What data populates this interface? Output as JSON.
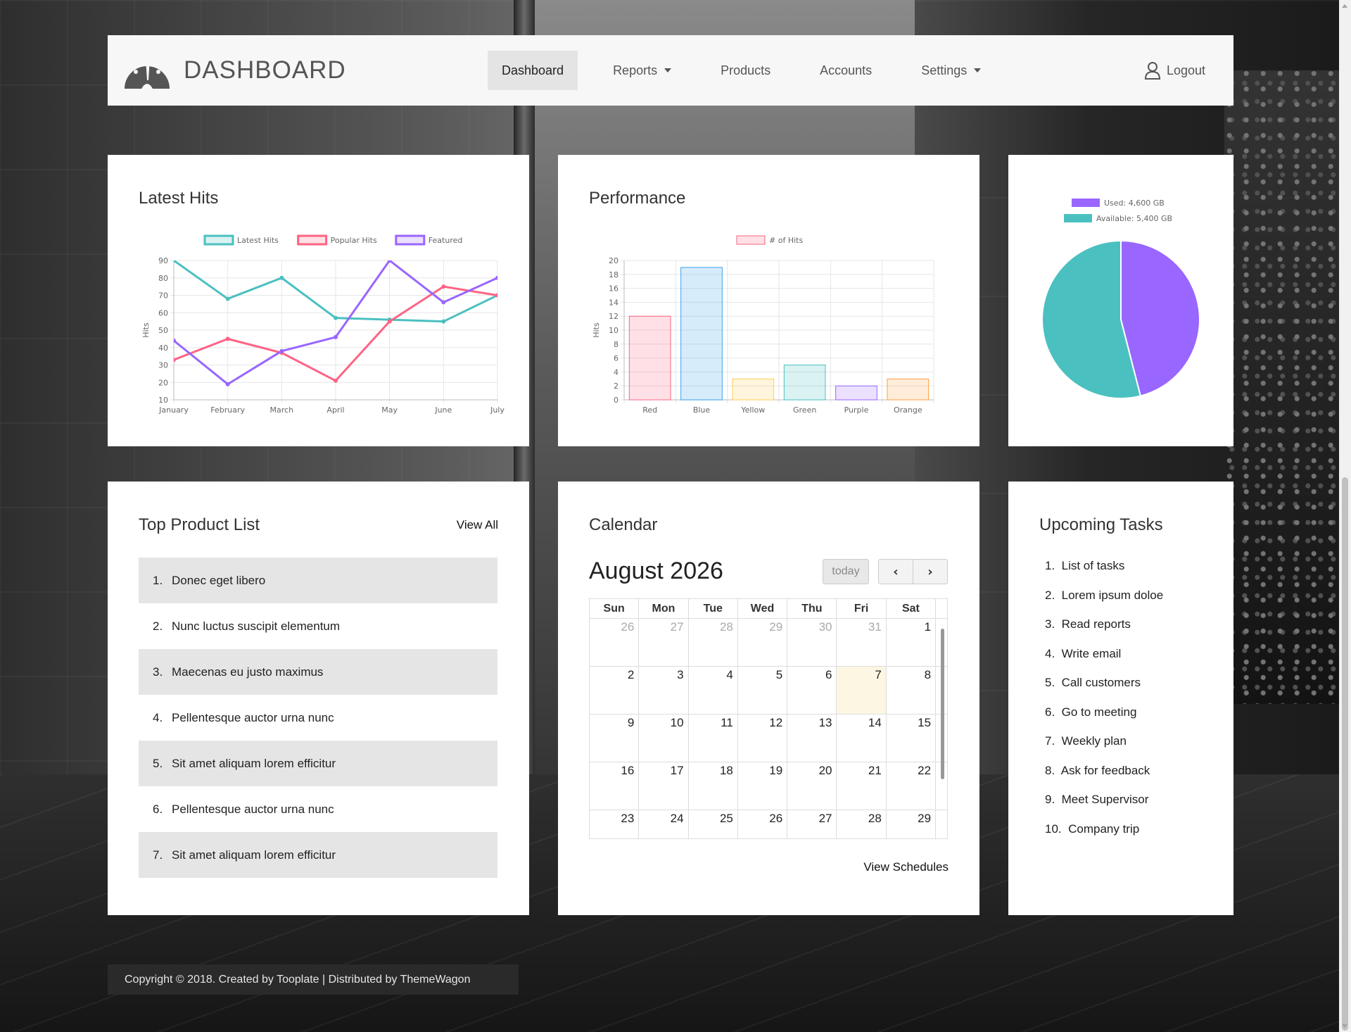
{
  "brand": {
    "title": "DASHBOARD",
    "icon": "speedometer-icon"
  },
  "nav": {
    "items": [
      {
        "label": "Dashboard",
        "active": true
      },
      {
        "label": "Reports",
        "dropdown": true
      },
      {
        "label": "Products"
      },
      {
        "label": "Accounts"
      },
      {
        "label": "Settings",
        "dropdown": true
      }
    ],
    "logout": "Logout"
  },
  "latest_hits": {
    "title": "Latest Hits",
    "chart_data": {
      "type": "line",
      "categories": [
        "January",
        "February",
        "March",
        "April",
        "May",
        "June",
        "July"
      ],
      "series": [
        {
          "name": "Latest Hits",
          "color": "#4bc0c0",
          "values": [
            90,
            68,
            80,
            57,
            56,
            55,
            70
          ]
        },
        {
          "name": "Popular Hits",
          "color": "#ff6384",
          "values": [
            33,
            45,
            37,
            21,
            55,
            75,
            70
          ]
        },
        {
          "name": "Featured",
          "color": "#9966ff",
          "values": [
            44,
            19,
            38,
            46,
            90,
            66,
            80
          ]
        }
      ],
      "ylabel": "Hits",
      "ylim": [
        10,
        90
      ],
      "yticks": [
        10,
        20,
        30,
        40,
        50,
        60,
        70,
        80,
        90
      ],
      "legend": "top"
    }
  },
  "performance": {
    "title": "Performance",
    "chart_data": {
      "type": "bar",
      "categories": [
        "Red",
        "Blue",
        "Yellow",
        "Green",
        "Purple",
        "Orange"
      ],
      "series": [
        {
          "name": "# of Hits",
          "values": [
            12,
            19,
            3,
            5,
            2,
            3
          ]
        }
      ],
      "colors": [
        "#ff6384",
        "#36a2eb",
        "#ffce56",
        "#4bc0c0",
        "#9966ff",
        "#ff9f40"
      ],
      "ylabel": "Hits",
      "ylim": [
        0,
        20
      ],
      "yticks": [
        0,
        2,
        4,
        6,
        8,
        10,
        12,
        14,
        16,
        18,
        20
      ],
      "legend": "top"
    }
  },
  "storage": {
    "chart_data": {
      "type": "pie",
      "labels": [
        "Used: 4,600 GB",
        "Available: 5,400 GB"
      ],
      "values": [
        4600,
        5400
      ],
      "colors": [
        "#9966ff",
        "#4bc0c0"
      ],
      "legend": "top"
    }
  },
  "products": {
    "title": "Top Product List",
    "view_all": "View All",
    "items": [
      "Donec eget libero",
      "Nunc luctus suscipit elementum",
      "Maecenas eu justo maximus",
      "Pellentesque auctor urna nunc",
      "Sit amet aliquam lorem efficitur",
      "Pellentesque auctor urna nunc",
      "Sit amet aliquam lorem efficitur"
    ]
  },
  "calendar": {
    "title": "Calendar",
    "month": "August 2026",
    "today_label": "today",
    "weekdays": [
      "Sun",
      "Mon",
      "Tue",
      "Wed",
      "Thu",
      "Fri",
      "Sat"
    ],
    "weeks": [
      [
        "26",
        "27",
        "28",
        "29",
        "30",
        "31",
        "1"
      ],
      [
        "2",
        "3",
        "4",
        "5",
        "6",
        "7",
        "8"
      ],
      [
        "9",
        "10",
        "11",
        "12",
        "13",
        "14",
        "15"
      ],
      [
        "16",
        "17",
        "18",
        "19",
        "20",
        "21",
        "22"
      ],
      [
        "23",
        "24",
        "25",
        "26",
        "27",
        "28",
        "29"
      ]
    ],
    "today": "7",
    "view_schedules": "View Schedules"
  },
  "tasks": {
    "title": "Upcoming Tasks",
    "items": [
      "List of tasks",
      "Lorem ipsum doloe",
      "Read reports",
      "Write email",
      "Call customers",
      "Go to meeting",
      "Weekly plan",
      "Ask for feedback",
      "Meet Supervisor",
      "Company trip"
    ]
  },
  "footer": {
    "text": "Copyright © 2018. Created by Tooplate | Distributed by ThemeWagon"
  }
}
